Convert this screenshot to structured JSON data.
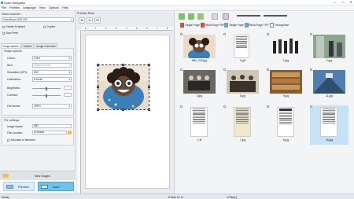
{
  "window": {
    "title": "Scan Navigator",
    "controls": [
      "—",
      "□",
      "✕"
    ]
  },
  "menu": [
    "File",
    "Profiles",
    "Language",
    "View",
    "Options",
    "Help"
  ],
  "left": {
    "select_scanner_label": "Select scanner:",
    "scanner_value": "CanoScan LiDE 220",
    "feeder_enabled_label": "Feeder Enabled",
    "duplex_label": "Duplex",
    "auto_feed_label": "Auto Feed",
    "tabs": [
      "Image options",
      "Options",
      "Image Correction"
    ],
    "image_options_label": "Image options",
    "colors_label": "Colors:",
    "colors_value": "Color",
    "size_label": "Size:",
    "size_value": "Maximum size",
    "resolution_label": "Resolution (DPI):",
    "resolution_value": "300",
    "orientation_label": "Orientation:",
    "orientation_value": "Portrait",
    "brightness_label": "Brightness:",
    "contrast_label": "Contrast:",
    "format_label": "File format:",
    "format_value": "JPEG",
    "file_settings_label": "File settings:",
    "image_name_label": "Image Name:",
    "image_name_value": "IMG",
    "file_location_label": "File Location:",
    "file_location_value": "D:\\Scans",
    "add_date_label": "Add date to filename",
    "new_images_label": "New images",
    "preview_label": "Preview",
    "scan_label": "Scan"
  },
  "preview": {
    "title": "Preview Pane",
    "ruler_ticks": [
      "0",
      "1",
      "2",
      "3",
      "4",
      "5",
      "6",
      "7",
      "8"
    ]
  },
  "right": {
    "toolbar": {
      "single_pdf_label": "Single Page PDF",
      "multi_pdf_label": "Multi-Page PDF",
      "single_tiff_label": "Single Page TIFF",
      "multi_tiff_label": "Multi-Page TIFF",
      "recognition_label": "Recognition"
    },
    "thumbnails": [
      {
        "label": "IMG_003.jpg",
        "kind": "photo"
      },
      {
        "label": "6.gif",
        "kind": "doc"
      },
      {
        "label": "1.jpg",
        "kind": "people"
      },
      {
        "label": "2.jpg",
        "kind": "street"
      },
      {
        "label": "3.jpg",
        "kind": "vintage"
      },
      {
        "label": "6.jpg",
        "kind": "group"
      },
      {
        "label": "9.jpg",
        "kind": "library"
      },
      {
        "label": "11.jpg",
        "kind": "stairs"
      },
      {
        "label": "2.jpg",
        "kind": "doc"
      },
      {
        "label": "5.jpg",
        "kind": "docsign"
      },
      {
        "label": "1.tif",
        "kind": "doc"
      },
      {
        "label": "7.jpg",
        "kind": "oldpaper"
      },
      {
        "label": "6.jpg",
        "kind": "newspaper"
      },
      {
        "label": "18.jpg",
        "kind": "doc"
      },
      {
        "label": "16.jpg",
        "kind": "bluedoc"
      }
    ],
    "selected_index": 14
  },
  "status": {
    "left": "Ready",
    "size": "8.26x4.21 in",
    "count": "12 file(s)"
  }
}
